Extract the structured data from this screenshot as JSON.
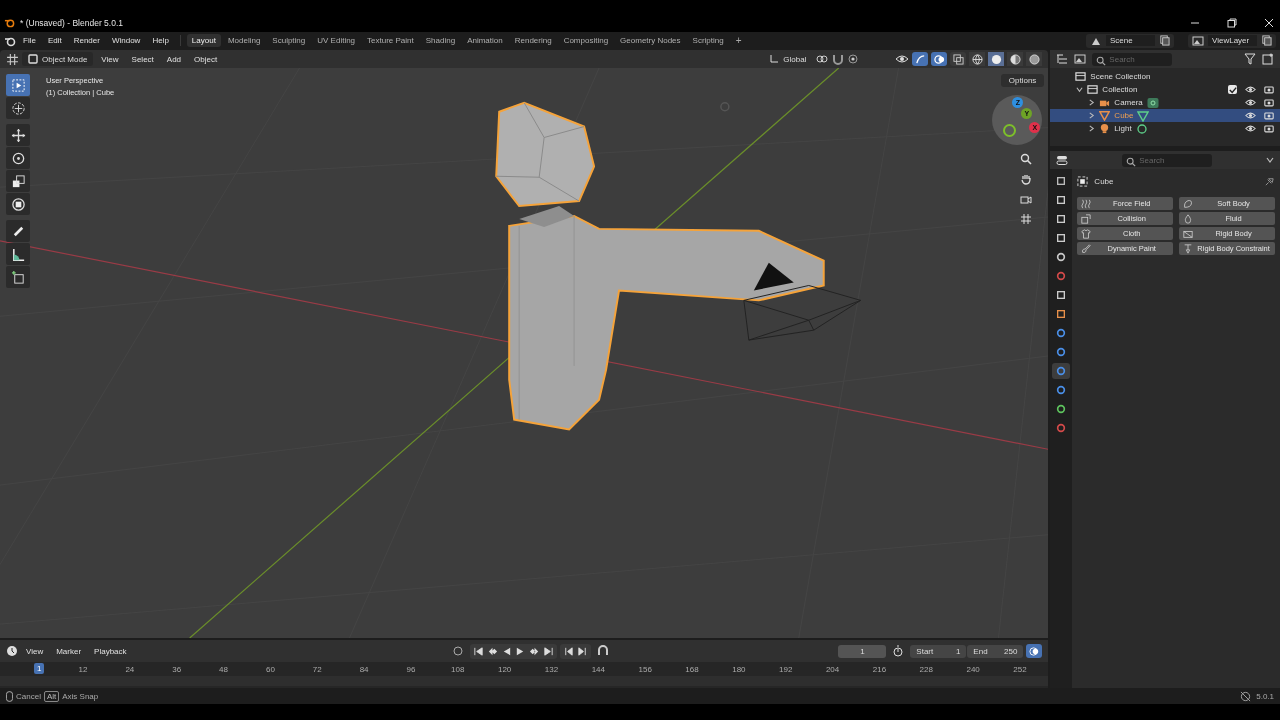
{
  "window": {
    "title": "* (Unsaved) - Blender 5.0.1"
  },
  "menu": [
    "File",
    "Edit",
    "Render",
    "Window",
    "Help"
  ],
  "workspaces": [
    {
      "label": "Layout",
      "selected": true
    },
    {
      "label": "Modeling",
      "selected": false
    },
    {
      "label": "Sculpting",
      "selected": false
    },
    {
      "label": "UV Editing",
      "selected": false
    },
    {
      "label": "Texture Paint",
      "selected": false
    },
    {
      "label": "Shading",
      "selected": false
    },
    {
      "label": "Animation",
      "selected": false
    },
    {
      "label": "Rendering",
      "selected": false
    },
    {
      "label": "Compositing",
      "selected": false
    },
    {
      "label": "Geometry Nodes",
      "selected": false
    },
    {
      "label": "Scripting",
      "selected": false
    }
  ],
  "add_workspace": "+",
  "viewport_header": {
    "mode": "Object Mode",
    "menus": [
      "View",
      "Select",
      "Add",
      "Object"
    ],
    "orientation": "Global",
    "shading_modes": [
      {
        "kind": "wireframe",
        "selected": false
      },
      {
        "kind": "solid",
        "selected": true
      },
      {
        "kind": "material",
        "selected": false
      },
      {
        "kind": "rendered",
        "selected": false
      }
    ]
  },
  "viewport": {
    "overlay_lines": [
      "User Perspective",
      "(1) Collection | Cube"
    ],
    "options": "Options",
    "tools": [
      {
        "kind": "select",
        "selected": true
      },
      {
        "kind": "cursor",
        "selected": false
      },
      {
        "kind": "move",
        "selected": false
      },
      {
        "kind": "rotate",
        "selected": false
      },
      {
        "kind": "scale",
        "selected": false
      },
      {
        "kind": "transform",
        "selected": false
      },
      {
        "kind": "annotate",
        "selected": false
      },
      {
        "kind": "measure",
        "selected": false
      },
      {
        "kind": "add-cube",
        "selected": false
      }
    ],
    "gizmo": [
      "Z",
      "Y",
      "X"
    ]
  },
  "scene": {
    "name": "Scene",
    "view_layer": "ViewLayer"
  },
  "outliner": {
    "search": {
      "placeholder": "Search"
    },
    "tree": [
      {
        "label": "Scene Collection",
        "kind": "scene-collection",
        "selected": false,
        "children": [
          {
            "label": "Collection",
            "kind": "collection",
            "expanded": true,
            "checked": true,
            "selected": false,
            "children": [
              {
                "label": "Camera",
                "kind": "camera",
                "expanded": false,
                "selected": false
              },
              {
                "label": "Cube",
                "kind": "mesh",
                "expanded": false,
                "selected": true
              },
              {
                "label": "Light",
                "kind": "light",
                "expanded": false,
                "selected": false
              }
            ]
          }
        ]
      }
    ]
  },
  "properties": {
    "search": {
      "placeholder": "Search"
    },
    "object": "Cube",
    "tabs": [
      {
        "kind": "tool",
        "selected": false
      },
      {
        "kind": "render",
        "selected": false
      },
      {
        "kind": "output",
        "selected": false
      },
      {
        "kind": "view-layer",
        "selected": false
      },
      {
        "kind": "scene",
        "selected": false
      },
      {
        "kind": "world",
        "selected": false
      },
      {
        "kind": "collection",
        "selected": false
      },
      {
        "kind": "object",
        "selected": false
      },
      {
        "kind": "modifier",
        "selected": false
      },
      {
        "kind": "particles",
        "selected": false
      },
      {
        "kind": "physics",
        "selected": true
      },
      {
        "kind": "constraints",
        "selected": false
      },
      {
        "kind": "data",
        "selected": false
      },
      {
        "kind": "material",
        "selected": false
      }
    ],
    "buttons": [
      {
        "label": "Force Field",
        "kind": "force-field"
      },
      {
        "label": "Soft Body",
        "kind": "soft-body"
      },
      {
        "label": "Collision",
        "kind": "collision"
      },
      {
        "label": "Fluid",
        "kind": "fluid"
      },
      {
        "label": "Cloth",
        "kind": "cloth"
      },
      {
        "label": "Rigid Body",
        "kind": "rigid-body"
      },
      {
        "label": "Dynamic Paint",
        "kind": "dynamic-paint"
      },
      {
        "label": "Rigid Body Constraint",
        "kind": "constraint"
      }
    ]
  },
  "timeline": {
    "menus": [
      "View",
      "Marker",
      "Playback"
    ],
    "current_frame": "1",
    "start": {
      "label": "Start",
      "value": "1"
    },
    "end": {
      "label": "End",
      "value": "250"
    },
    "playhead": "1",
    "ticks": [
      "12",
      "24",
      "36",
      "48",
      "60",
      "72",
      "84",
      "96",
      "108",
      "120",
      "132",
      "144",
      "156",
      "168",
      "180",
      "192",
      "204",
      "216",
      "228",
      "240",
      "252"
    ]
  },
  "status_bar": {
    "cancel": "Cancel",
    "key": "Alt",
    "hint": "Axis Snap",
    "version": "5.0.1"
  }
}
